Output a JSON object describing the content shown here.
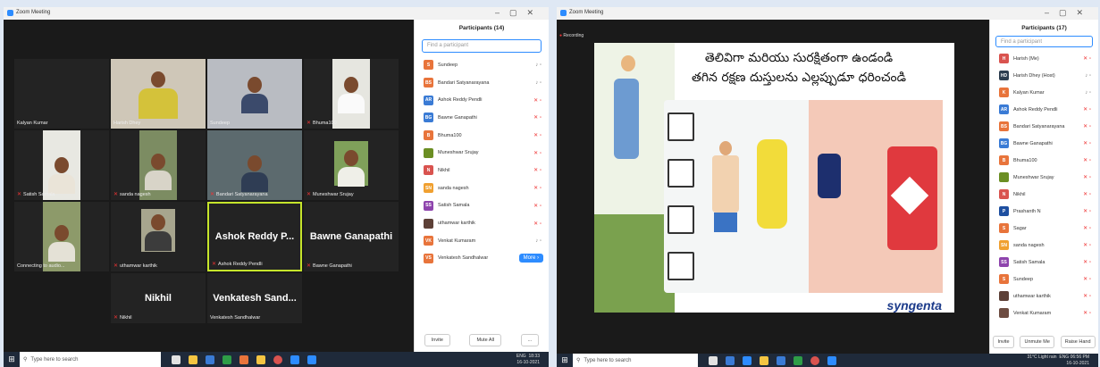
{
  "left": {
    "window_title": "Zoom Meeting",
    "tiles": [
      {
        "name": "Kalyan Kumar",
        "muted": false,
        "big": ""
      },
      {
        "name": "Harish Dhey",
        "muted": false,
        "big": ""
      },
      {
        "name": "Sundeep",
        "muted": false,
        "big": ""
      },
      {
        "name": "Bhuma100",
        "muted": true,
        "big": ""
      },
      {
        "name": "Satish Samala",
        "muted": true,
        "big": ""
      },
      {
        "name": "sanda nagesh",
        "muted": true,
        "big": ""
      },
      {
        "name": "Bandari Satyanarayana",
        "muted": true,
        "big": ""
      },
      {
        "name": "Muneshwar Srujay",
        "muted": true,
        "big": ""
      },
      {
        "name": "Connecting to audio...",
        "muted": false,
        "big": ""
      },
      {
        "name": "uthamwar karthik",
        "muted": true,
        "big": ""
      },
      {
        "name": "Ashok Reddy Pendli",
        "muted": true,
        "big": "Ashok  Reddy  P..."
      },
      {
        "name": "Bawne Ganapathi",
        "muted": true,
        "big": "Bawne Ganapathi"
      },
      {
        "name": "Nikhil",
        "muted": true,
        "big": "Nikhil"
      },
      {
        "name": "Venkatesh Sandhalwar",
        "muted": false,
        "big": "Venkatesh  Sand..."
      }
    ],
    "panel": {
      "title": "Participants (14)",
      "search_placeholder": "Find a participant",
      "participants": [
        {
          "initials": "S",
          "name": "Sundeep",
          "color": "#e8743b",
          "muted": false
        },
        {
          "initials": "BS",
          "name": "Bandari Satyanarayana",
          "color": "#e8743b",
          "muted": false
        },
        {
          "initials": "AR",
          "name": "Ashok Reddy Pendli",
          "color": "#3a7bd5",
          "muted": true
        },
        {
          "initials": "BG",
          "name": "Bawne Ganapathi",
          "color": "#3a7bd5",
          "muted": true
        },
        {
          "initials": "B",
          "name": "Bhuma100",
          "color": "#e8743b",
          "muted": true
        },
        {
          "initials": "",
          "name": "Muneshwar Srujay",
          "color": "#6b8e23",
          "muted": true
        },
        {
          "initials": "N",
          "name": "Nikhil",
          "color": "#d9534f",
          "muted": true
        },
        {
          "initials": "SN",
          "name": "sanda nagesh",
          "color": "#f0a030",
          "muted": true
        },
        {
          "initials": "SS",
          "name": "Satish Samala",
          "color": "#8e44ad",
          "muted": true
        },
        {
          "initials": "",
          "name": "uthamwar karthik",
          "color": "#5d4037",
          "muted": true
        },
        {
          "initials": "VK",
          "name": "Venkat Kumaram",
          "color": "#e8743b",
          "muted": false
        },
        {
          "initials": "VS",
          "name": "Venkatesh Sandhalwar",
          "color": "#e8743b",
          "muted": false
        }
      ],
      "more_label": "More ›",
      "invite_label": "Invite",
      "mute_all_label": "Mute All",
      "dots_label": "..."
    },
    "taskbar": {
      "search": "Type here to search",
      "time": "18:33",
      "date": "16-10-2021",
      "lang": "ENG"
    }
  },
  "right": {
    "window_title": "Zoom Meeting",
    "recording": "Recording",
    "slide": {
      "line1": "తెలివిగా మరియు సురక్షితంగా ఉండండి",
      "line2": "తగిన రక్షణ దుస్తులను ఎల్లప్పుడూ ధరించండి",
      "brand": "syngenta"
    },
    "panel": {
      "title": "Participants (17)",
      "search_placeholder": "Find a participant",
      "participants": [
        {
          "initials": "H",
          "name": "Harish (Me)",
          "color": "#d9534f",
          "muted": true
        },
        {
          "initials": "HD",
          "name": "Harish Dhey (Host)",
          "color": "#2d3e50",
          "muted": false
        },
        {
          "initials": "K",
          "name": "Kalyan Kumar",
          "color": "#e8743b",
          "muted": false
        },
        {
          "initials": "AR",
          "name": "Ashok Reddy Pendli",
          "color": "#3a7bd5",
          "muted": true
        },
        {
          "initials": "BS",
          "name": "Bandari Satyanarayana",
          "color": "#e8743b",
          "muted": true
        },
        {
          "initials": "BG",
          "name": "Bawne Ganapathi",
          "color": "#3a7bd5",
          "muted": true
        },
        {
          "initials": "B",
          "name": "Bhuma100",
          "color": "#e8743b",
          "muted": true
        },
        {
          "initials": "",
          "name": "Muneshwar Srujay",
          "color": "#6b8e23",
          "muted": true
        },
        {
          "initials": "N",
          "name": "Nikhil",
          "color": "#d9534f",
          "muted": true
        },
        {
          "initials": "P",
          "name": "Prashanth N",
          "color": "#1e4fa0",
          "muted": true
        },
        {
          "initials": "S",
          "name": "Sagar",
          "color": "#e8743b",
          "muted": true
        },
        {
          "initials": "SN",
          "name": "sanda nagesh",
          "color": "#f0a030",
          "muted": true
        },
        {
          "initials": "SS",
          "name": "Satish Samala",
          "color": "#8e44ad",
          "muted": true
        },
        {
          "initials": "S",
          "name": "Sundeep",
          "color": "#e8743b",
          "muted": true
        },
        {
          "initials": "",
          "name": "uthamwar karthik",
          "color": "#5d4037",
          "muted": true
        },
        {
          "initials": "",
          "name": "Venkat Kumaram",
          "color": "#6d4c41",
          "muted": true
        }
      ],
      "invite_label": "Invite",
      "unmute_me_label": "Unmute Me",
      "raise_hand_label": "Raise Hand"
    },
    "taskbar": {
      "search": "Type here to search",
      "weather": "31°C Light rain",
      "time": "06:56 PM",
      "date": "16-10-2021",
      "lang": "ENG"
    }
  }
}
